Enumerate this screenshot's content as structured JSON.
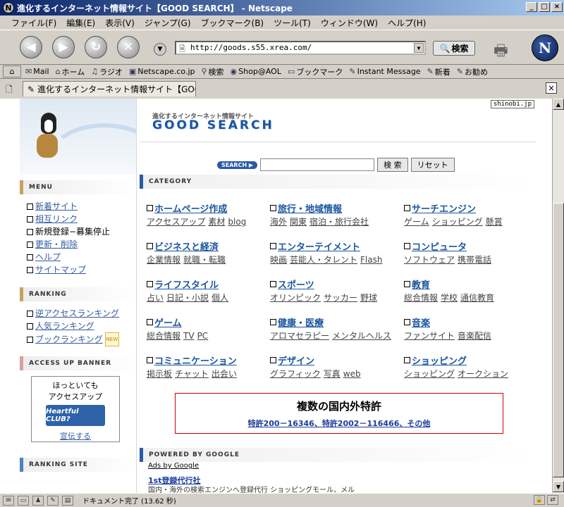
{
  "window": {
    "title": "進化するインターネット情報サイト【GOOD SEARCH】 - Netscape",
    "controls": {
      "minimize": "_",
      "maximize": "□",
      "close": "×"
    }
  },
  "menu": [
    "ファイル(F)",
    "編集(E)",
    "表示(V)",
    "ジャンプ(G)",
    "ブックマーク(B)",
    "ツール(T)",
    "ウィンドウ(W)",
    "ヘルプ(H)"
  ],
  "navigation": {
    "back_icon": "back-arrow-icon",
    "forward_icon": "forward-arrow-icon",
    "reload_icon": "reload-icon",
    "stop_icon": "stop-icon",
    "url": "http://goods.s55.xrea.com/",
    "search_button": "検索"
  },
  "bookmarks": [
    "Mail",
    "ホーム",
    "ラジオ",
    "Netscape.co.jp",
    "検索",
    "Shop@AOL",
    "ブックマーク",
    "Instant Message",
    "新着",
    "お勧め"
  ],
  "tab": {
    "title": "進化するインターネット情報サイト【GOOD SE..."
  },
  "page": {
    "shinobi": "shinobi.jp",
    "subtitle": "進化するインターネット情報サイト",
    "site_title": "GOOD SEARCH",
    "search": {
      "label": "SEARCH ▶",
      "submit": "検 索",
      "reset": "リセット"
    },
    "category_heading": "CATEGORY",
    "categories": [
      {
        "name": "ホームページ作成",
        "subs": [
          "アクセスアップ",
          "素材",
          "blog"
        ]
      },
      {
        "name": "旅行・地域情報",
        "subs": [
          "海外",
          "関東",
          "宿泊・旅行会社"
        ]
      },
      {
        "name": "サーチエンジン",
        "subs": [
          "ゲーム",
          "ショッピング",
          "懸賞"
        ]
      },
      {
        "name": "ビジネスと経済",
        "subs": [
          "企業情報",
          "就職・転職"
        ]
      },
      {
        "name": "エンターテイメント",
        "subs": [
          "映画",
          "芸能人・タレント",
          "Flash"
        ]
      },
      {
        "name": "コンピュータ",
        "subs": [
          "ソフトウェア",
          "携帯電話"
        ]
      },
      {
        "name": "ライフスタイル",
        "subs": [
          "占い",
          "日記・小説",
          "個人"
        ]
      },
      {
        "name": "スポーツ",
        "subs": [
          "オリンピック",
          "サッカー",
          "野球"
        ]
      },
      {
        "name": "教育",
        "subs": [
          "総合情報",
          "学校",
          "通信教育"
        ]
      },
      {
        "name": "ゲーム",
        "subs": [
          "総合情報",
          "TV",
          "PC"
        ]
      },
      {
        "name": "健康・医療",
        "subs": [
          "アロマセラピー",
          "メンタルヘルス"
        ]
      },
      {
        "name": "音楽",
        "subs": [
          "ファンサイト",
          "音楽配信"
        ]
      },
      {
        "name": "コミュニケーション",
        "subs": [
          "掲示板",
          "チャット",
          "出会い"
        ]
      },
      {
        "name": "デザイン",
        "subs": [
          "グラフィック",
          "写真",
          "web"
        ]
      },
      {
        "name": "ショッピング",
        "subs": [
          "ショッピング",
          "オークション"
        ]
      }
    ],
    "patent": {
      "title": "複数の国内外特許",
      "link": "特許200－16346、特許2002－116466、その他"
    },
    "google_heading": "POWERED BY GOOGLE",
    "ads_by": "Ads by Google",
    "ad_title": "1st登録代行社",
    "ad_desc": "国内・海外の検索エンジンへ登録代行 ショッピングモール、メル"
  },
  "sidebar": {
    "menu_heading": "MENU",
    "menu_items": [
      {
        "label": "新着サイト",
        "link": true
      },
      {
        "label": "相互リンク",
        "link": true
      },
      {
        "label": "新規登録−募集停止",
        "link": false
      },
      {
        "label": "更新・削除",
        "link": true
      },
      {
        "label": "ヘルプ",
        "link": true
      },
      {
        "label": "サイトマップ",
        "link": true
      }
    ],
    "ranking_heading": "RANKING",
    "ranking_items": [
      "逆アクセスランキング",
      "人気ランキング",
      "ブックランキング"
    ],
    "new_badge": "NEW",
    "banner_heading": "ACCESS UP BANNER",
    "banner_text1": "ほっといても",
    "banner_text2": "アクセスアップ",
    "banner_image": "Heartful CLUB?",
    "banner_link": "宣伝する",
    "ranking_site_heading": "RANKING SITE"
  },
  "status": {
    "text": "ドキュメント完了 (13.62 秒)"
  }
}
